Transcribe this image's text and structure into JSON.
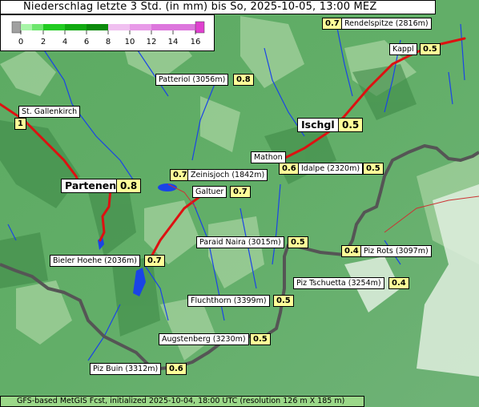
{
  "title": "Niederschlag letzte 3 Std. (in mm) bis So, 2025-10-05, 13:00 MEZ",
  "footer": "GFS-based MetGIS Fcst, initialized 2025-10-04, 18:00 UTC  (resolution 126 m X 185 m)",
  "legend": {
    "ticks": [
      "0",
      "2",
      "4",
      "6",
      "8",
      "10",
      "12",
      "14",
      "16"
    ],
    "colors": [
      "#a0a0a0",
      "#a8f5a8",
      "#6ee66e",
      "#22cc22",
      "#11aa11",
      "#0c8a0c",
      "#f0c0f0",
      "#e89be8",
      "#dd77dd",
      "#e040d0"
    ]
  },
  "places": [
    {
      "name": "Rendelspitze (2816m)",
      "value": "0.7"
    },
    {
      "name": "Kappl",
      "value": "0.5"
    },
    {
      "name": "Patteriol (3056m)",
      "value": "0.8"
    },
    {
      "name": "St. Gallenkirch",
      "value": "1"
    },
    {
      "name": "Ischgl",
      "value": "0.5"
    },
    {
      "name": "Mathon",
      "value": "0.6"
    },
    {
      "name": "Idalpe (2320m)",
      "value": "0.5"
    },
    {
      "name": "Zeinisjoch (1842m)",
      "value": "0.7"
    },
    {
      "name": "Partenen",
      "value": "0.8"
    },
    {
      "name": "Galtuer",
      "value": "0.7"
    },
    {
      "name": "Paraid Naira (3015m)",
      "value": "0.5"
    },
    {
      "name": "Piz Rots (3097m)",
      "value": "0.4"
    },
    {
      "name": "Bieler Hoehe (2036m)",
      "value": "0.7"
    },
    {
      "name": "Piz Tschuetta (3254m)",
      "value": "0.4"
    },
    {
      "name": "Fluchthorn (3399m)",
      "value": "0.5"
    },
    {
      "name": "Augstenberg (3230m)",
      "value": "0.5"
    },
    {
      "name": "Piz Buin (3312m)",
      "value": "0.6"
    }
  ]
}
